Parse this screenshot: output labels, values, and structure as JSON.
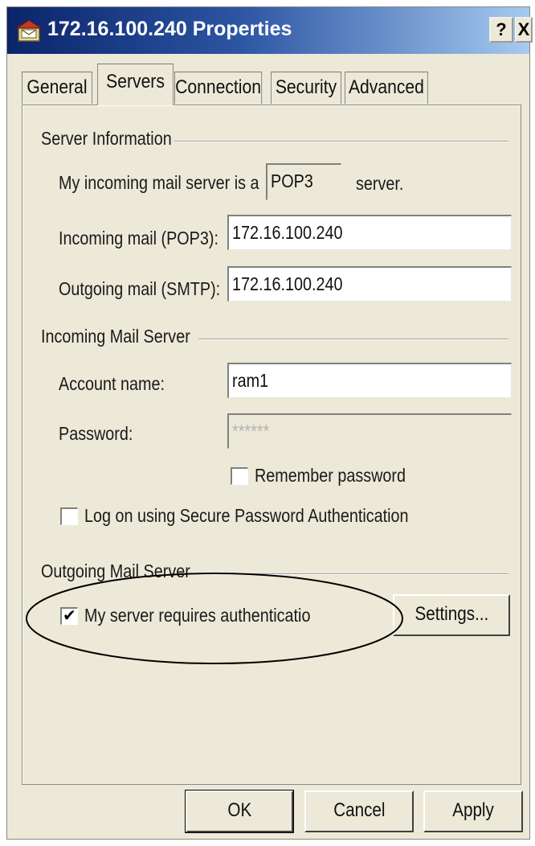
{
  "window": {
    "title": "172.16.100.240 Properties",
    "help_button": "?",
    "close_button": "X"
  },
  "tabs": [
    {
      "label": "General",
      "active": false
    },
    {
      "label": "Servers",
      "active": true
    },
    {
      "label": "Connection",
      "active": false
    },
    {
      "label": "Security",
      "active": false
    },
    {
      "label": "Advanced",
      "active": false
    }
  ],
  "server_info": {
    "group_label": "Server Information",
    "incoming_type_prefix": "My incoming mail server is a",
    "incoming_type_value": "POP3",
    "incoming_type_suffix": "server.",
    "incoming_label": "Incoming mail (POP3):",
    "incoming_value": "172.16.100.240",
    "outgoing_label": "Outgoing mail (SMTP):",
    "outgoing_value": "172.16.100.240"
  },
  "incoming_server": {
    "group_label": "Incoming Mail Server",
    "account_label": "Account name:",
    "account_value": "ram1",
    "password_label": "Password:",
    "password_value": "******",
    "remember_password_label": "Remember password",
    "remember_password_checked": false,
    "spa_label": "Log on using Secure Password Authentication",
    "spa_checked": false
  },
  "outgoing_server": {
    "group_label": "Outgoing Mail Server",
    "auth_label": "My server requires authenticatio",
    "auth_checked": true,
    "settings_button": "Settings..."
  },
  "buttons": {
    "ok": "OK",
    "cancel": "Cancel",
    "apply": "Apply"
  },
  "checkmark_glyph": "✔"
}
